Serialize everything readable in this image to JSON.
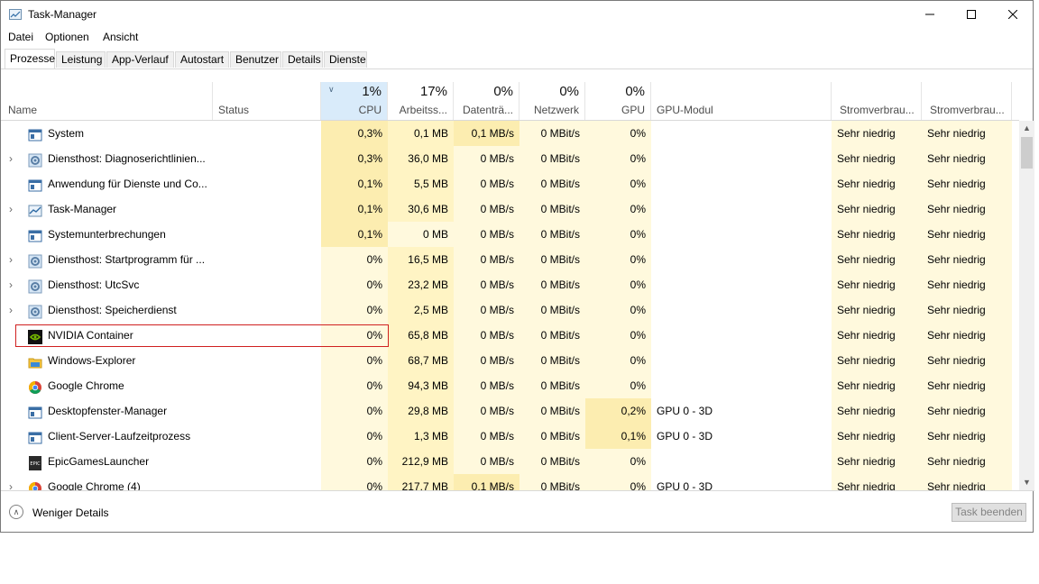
{
  "window": {
    "title": "Task-Manager"
  },
  "menu": [
    "Datei",
    "Optionen",
    "Ansicht"
  ],
  "tabs": [
    "Prozesse",
    "Leistung",
    "App-Verlauf",
    "Autostart",
    "Benutzer",
    "Details",
    "Dienste"
  ],
  "columns": {
    "name": "Name",
    "status": "Status",
    "cpu": {
      "pct": "1%",
      "label": "CPU"
    },
    "mem": {
      "pct": "17%",
      "label": "Arbeitss..."
    },
    "disk": {
      "pct": "0%",
      "label": "Datenträ..."
    },
    "net": {
      "pct": "0%",
      "label": "Netzwerk"
    },
    "gpu": {
      "pct": "0%",
      "label": "GPU"
    },
    "gpu_engine": "GPU-Modul",
    "power": "Stromverbrau...",
    "power_trend": "Stromverbrau..."
  },
  "processes": [
    {
      "name": "System",
      "expandable": false,
      "icon": "service-window-icon",
      "cpu": "0,3%",
      "mem": "0,1 MB",
      "disk": "0,1 MB/s",
      "net": "0 MBit/s",
      "gpu": "0%",
      "gpu_engine": "",
      "power": "Sehr niedrig",
      "power_trend": "Sehr niedrig"
    },
    {
      "name": "Diensthost: Diagnoserichtlinien...",
      "expandable": true,
      "icon": "gear-icon",
      "cpu": "0,3%",
      "mem": "36,0 MB",
      "disk": "0 MB/s",
      "net": "0 MBit/s",
      "gpu": "0%",
      "gpu_engine": "",
      "power": "Sehr niedrig",
      "power_trend": "Sehr niedrig"
    },
    {
      "name": "Anwendung für Dienste und Co...",
      "expandable": false,
      "icon": "service-window-icon",
      "cpu": "0,1%",
      "mem": "5,5 MB",
      "disk": "0 MB/s",
      "net": "0 MBit/s",
      "gpu": "0%",
      "gpu_engine": "",
      "power": "Sehr niedrig",
      "power_trend": "Sehr niedrig"
    },
    {
      "name": "Task-Manager",
      "expandable": true,
      "icon": "task-manager-icon",
      "cpu": "0,1%",
      "mem": "30,6 MB",
      "disk": "0 MB/s",
      "net": "0 MBit/s",
      "gpu": "0%",
      "gpu_engine": "",
      "power": "Sehr niedrig",
      "power_trend": "Sehr niedrig"
    },
    {
      "name": "Systemunterbrechungen",
      "expandable": false,
      "icon": "service-window-icon",
      "cpu": "0,1%",
      "mem": "0 MB",
      "disk": "0 MB/s",
      "net": "0 MBit/s",
      "gpu": "0%",
      "gpu_engine": "",
      "power": "Sehr niedrig",
      "power_trend": "Sehr niedrig"
    },
    {
      "name": "Diensthost: Startprogramm für ...",
      "expandable": true,
      "icon": "gear-icon",
      "cpu": "0%",
      "mem": "16,5 MB",
      "disk": "0 MB/s",
      "net": "0 MBit/s",
      "gpu": "0%",
      "gpu_engine": "",
      "power": "Sehr niedrig",
      "power_trend": "Sehr niedrig"
    },
    {
      "name": "Diensthost: UtcSvc",
      "expandable": true,
      "icon": "gear-icon",
      "cpu": "0%",
      "mem": "23,2 MB",
      "disk": "0 MB/s",
      "net": "0 MBit/s",
      "gpu": "0%",
      "gpu_engine": "",
      "power": "Sehr niedrig",
      "power_trend": "Sehr niedrig"
    },
    {
      "name": "Diensthost: Speicherdienst",
      "expandable": true,
      "icon": "gear-icon",
      "cpu": "0%",
      "mem": "2,5 MB",
      "disk": "0 MB/s",
      "net": "0 MBit/s",
      "gpu": "0%",
      "gpu_engine": "",
      "power": "Sehr niedrig",
      "power_trend": "Sehr niedrig"
    },
    {
      "name": "NVIDIA Container",
      "expandable": false,
      "icon": "nvidia-icon",
      "cpu": "0%",
      "mem": "65,8 MB",
      "disk": "0 MB/s",
      "net": "0 MBit/s",
      "gpu": "0%",
      "gpu_engine": "",
      "power": "Sehr niedrig",
      "power_trend": "Sehr niedrig"
    },
    {
      "name": "Windows-Explorer",
      "expandable": false,
      "icon": "folder-icon",
      "cpu": "0%",
      "mem": "68,7 MB",
      "disk": "0 MB/s",
      "net": "0 MBit/s",
      "gpu": "0%",
      "gpu_engine": "",
      "power": "Sehr niedrig",
      "power_trend": "Sehr niedrig"
    },
    {
      "name": "Google Chrome",
      "expandable": false,
      "icon": "chrome-icon",
      "cpu": "0%",
      "mem": "94,3 MB",
      "disk": "0 MB/s",
      "net": "0 MBit/s",
      "gpu": "0%",
      "gpu_engine": "",
      "power": "Sehr niedrig",
      "power_trend": "Sehr niedrig"
    },
    {
      "name": "Desktopfenster-Manager",
      "expandable": false,
      "icon": "service-window-icon",
      "cpu": "0%",
      "mem": "29,8 MB",
      "disk": "0 MB/s",
      "net": "0 MBit/s",
      "gpu": "0,2%",
      "gpu_engine": "GPU 0 - 3D",
      "power": "Sehr niedrig",
      "power_trend": "Sehr niedrig"
    },
    {
      "name": "Client-Server-Laufzeitprozess",
      "expandable": false,
      "icon": "service-window-icon",
      "cpu": "0%",
      "mem": "1,3 MB",
      "disk": "0 MB/s",
      "net": "0 MBit/s",
      "gpu": "0,1%",
      "gpu_engine": "GPU 0 - 3D",
      "power": "Sehr niedrig",
      "power_trend": "Sehr niedrig"
    },
    {
      "name": "EpicGamesLauncher",
      "expandable": false,
      "icon": "epic-games-icon",
      "cpu": "0%",
      "mem": "212,9 MB",
      "disk": "0 MB/s",
      "net": "0 MBit/s",
      "gpu": "0%",
      "gpu_engine": "",
      "power": "Sehr niedrig",
      "power_trend": "Sehr niedrig"
    },
    {
      "name": "Google Chrome (4)",
      "expandable": true,
      "icon": "chrome-icon",
      "cpu": "0%",
      "mem": "217,7 MB",
      "disk": "0,1 MB/s",
      "net": "0 MBit/s",
      "gpu": "0%",
      "gpu_engine": "GPU 0 - 3D",
      "power": "Sehr niedrig",
      "power_trend": "Sehr niedrig"
    }
  ],
  "footer": {
    "less_details": "Weniger Details",
    "end_task": "Task beenden"
  },
  "colors": {
    "cpu_header": "#d9ebfa",
    "heat_low": "#fff9dd",
    "heat_mid": "#fff4c4",
    "heat_high": "#fcedb0",
    "highlight": "#d02020"
  }
}
